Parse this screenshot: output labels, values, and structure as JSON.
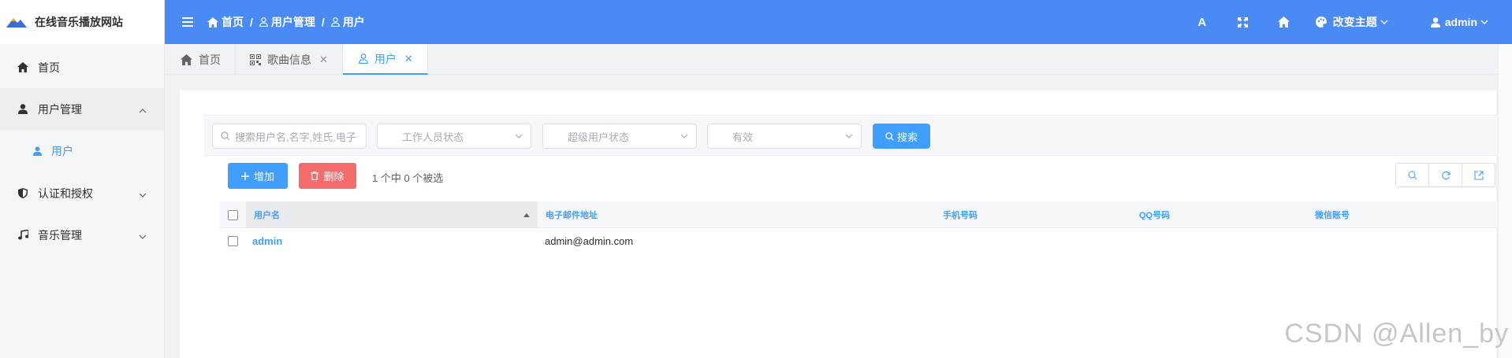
{
  "app": {
    "title": "在线音乐播放网站"
  },
  "sidebar": {
    "items": [
      {
        "label": "首页"
      },
      {
        "label": "用户管理"
      },
      {
        "label": "用户"
      },
      {
        "label": "认证和授权"
      },
      {
        "label": "音乐管理"
      }
    ]
  },
  "header": {
    "breadcrumb": [
      "首页",
      "用户管理",
      "用户"
    ],
    "separator": "/",
    "font_icon_glyph": "A",
    "theme_label": "改变主题",
    "user_label": "admin"
  },
  "tabs": [
    {
      "label": "首页",
      "closable": false,
      "active": false
    },
    {
      "label": "歌曲信息",
      "closable": true,
      "active": false
    },
    {
      "label": "用户",
      "closable": true,
      "active": true
    }
  ],
  "tab_close_glyph": "✕",
  "filters": {
    "search_placeholder": "搜索用户名,名字,姓氏,电子",
    "staff_status_placeholder": "工作人员状态",
    "superuser_status_placeholder": "超级用户状态",
    "active_placeholder": "有效",
    "search_button": "搜索"
  },
  "actions": {
    "add_label": "增加",
    "delete_label": "删除",
    "selection_info": "1 个中 0 个被选"
  },
  "table": {
    "columns": [
      "用户名",
      "电子邮件地址",
      "手机号码",
      "QQ号码",
      "微信账号"
    ],
    "rows": [
      {
        "username": "admin",
        "email": "admin@admin.com",
        "phone": "",
        "qq": "",
        "wechat": ""
      }
    ]
  },
  "watermark": "CSDN @Allen_by",
  "colors": {
    "header_bg": "#4a8af4",
    "primary": "#409eff",
    "danger": "#f56c6c",
    "sidebar_bg": "#f5f6f8"
  },
  "icons": {
    "home": "home-icon",
    "user": "user-icon",
    "shield": "shield-icon",
    "music": "music-icon",
    "hamburger": "hamburger-icon",
    "font": "font-size-icon",
    "fullscreen": "fullscreen-icon",
    "palette": "palette-icon",
    "search": "search-icon",
    "refresh": "refresh-icon",
    "export": "export-icon"
  }
}
